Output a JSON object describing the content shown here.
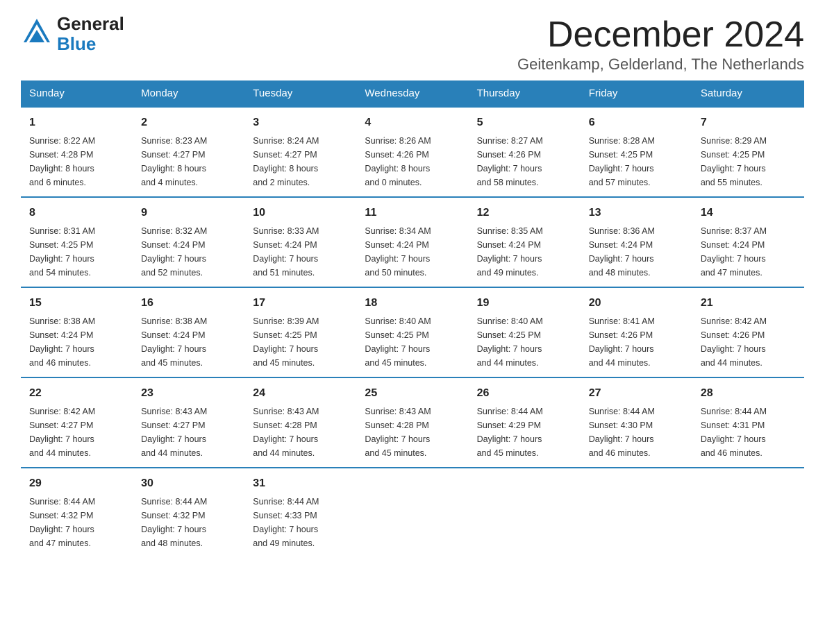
{
  "header": {
    "logo_general": "General",
    "logo_blue": "Blue",
    "title": "December 2024",
    "subtitle": "Geitenkamp, Gelderland, The Netherlands"
  },
  "columns": [
    "Sunday",
    "Monday",
    "Tuesday",
    "Wednesday",
    "Thursday",
    "Friday",
    "Saturday"
  ],
  "weeks": [
    [
      {
        "day": "1",
        "sunrise": "8:22 AM",
        "sunset": "4:28 PM",
        "daylight": "8 hours and 6 minutes."
      },
      {
        "day": "2",
        "sunrise": "8:23 AM",
        "sunset": "4:27 PM",
        "daylight": "8 hours and 4 minutes."
      },
      {
        "day": "3",
        "sunrise": "8:24 AM",
        "sunset": "4:27 PM",
        "daylight": "8 hours and 2 minutes."
      },
      {
        "day": "4",
        "sunrise": "8:26 AM",
        "sunset": "4:26 PM",
        "daylight": "8 hours and 0 minutes."
      },
      {
        "day": "5",
        "sunrise": "8:27 AM",
        "sunset": "4:26 PM",
        "daylight": "7 hours and 58 minutes."
      },
      {
        "day": "6",
        "sunrise": "8:28 AM",
        "sunset": "4:25 PM",
        "daylight": "7 hours and 57 minutes."
      },
      {
        "day": "7",
        "sunrise": "8:29 AM",
        "sunset": "4:25 PM",
        "daylight": "7 hours and 55 minutes."
      }
    ],
    [
      {
        "day": "8",
        "sunrise": "8:31 AM",
        "sunset": "4:25 PM",
        "daylight": "7 hours and 54 minutes."
      },
      {
        "day": "9",
        "sunrise": "8:32 AM",
        "sunset": "4:24 PM",
        "daylight": "7 hours and 52 minutes."
      },
      {
        "day": "10",
        "sunrise": "8:33 AM",
        "sunset": "4:24 PM",
        "daylight": "7 hours and 51 minutes."
      },
      {
        "day": "11",
        "sunrise": "8:34 AM",
        "sunset": "4:24 PM",
        "daylight": "7 hours and 50 minutes."
      },
      {
        "day": "12",
        "sunrise": "8:35 AM",
        "sunset": "4:24 PM",
        "daylight": "7 hours and 49 minutes."
      },
      {
        "day": "13",
        "sunrise": "8:36 AM",
        "sunset": "4:24 PM",
        "daylight": "7 hours and 48 minutes."
      },
      {
        "day": "14",
        "sunrise": "8:37 AM",
        "sunset": "4:24 PM",
        "daylight": "7 hours and 47 minutes."
      }
    ],
    [
      {
        "day": "15",
        "sunrise": "8:38 AM",
        "sunset": "4:24 PM",
        "daylight": "7 hours and 46 minutes."
      },
      {
        "day": "16",
        "sunrise": "8:38 AM",
        "sunset": "4:24 PM",
        "daylight": "7 hours and 45 minutes."
      },
      {
        "day": "17",
        "sunrise": "8:39 AM",
        "sunset": "4:25 PM",
        "daylight": "7 hours and 45 minutes."
      },
      {
        "day": "18",
        "sunrise": "8:40 AM",
        "sunset": "4:25 PM",
        "daylight": "7 hours and 45 minutes."
      },
      {
        "day": "19",
        "sunrise": "8:40 AM",
        "sunset": "4:25 PM",
        "daylight": "7 hours and 44 minutes."
      },
      {
        "day": "20",
        "sunrise": "8:41 AM",
        "sunset": "4:26 PM",
        "daylight": "7 hours and 44 minutes."
      },
      {
        "day": "21",
        "sunrise": "8:42 AM",
        "sunset": "4:26 PM",
        "daylight": "7 hours and 44 minutes."
      }
    ],
    [
      {
        "day": "22",
        "sunrise": "8:42 AM",
        "sunset": "4:27 PM",
        "daylight": "7 hours and 44 minutes."
      },
      {
        "day": "23",
        "sunrise": "8:43 AM",
        "sunset": "4:27 PM",
        "daylight": "7 hours and 44 minutes."
      },
      {
        "day": "24",
        "sunrise": "8:43 AM",
        "sunset": "4:28 PM",
        "daylight": "7 hours and 44 minutes."
      },
      {
        "day": "25",
        "sunrise": "8:43 AM",
        "sunset": "4:28 PM",
        "daylight": "7 hours and 45 minutes."
      },
      {
        "day": "26",
        "sunrise": "8:44 AM",
        "sunset": "4:29 PM",
        "daylight": "7 hours and 45 minutes."
      },
      {
        "day": "27",
        "sunrise": "8:44 AM",
        "sunset": "4:30 PM",
        "daylight": "7 hours and 46 minutes."
      },
      {
        "day": "28",
        "sunrise": "8:44 AM",
        "sunset": "4:31 PM",
        "daylight": "7 hours and 46 minutes."
      }
    ],
    [
      {
        "day": "29",
        "sunrise": "8:44 AM",
        "sunset": "4:32 PM",
        "daylight": "7 hours and 47 minutes."
      },
      {
        "day": "30",
        "sunrise": "8:44 AM",
        "sunset": "4:32 PM",
        "daylight": "7 hours and 48 minutes."
      },
      {
        "day": "31",
        "sunrise": "8:44 AM",
        "sunset": "4:33 PM",
        "daylight": "7 hours and 49 minutes."
      },
      null,
      null,
      null,
      null
    ]
  ],
  "labels": {
    "sunrise": "Sunrise:",
    "sunset": "Sunset:",
    "daylight": "Daylight:"
  }
}
